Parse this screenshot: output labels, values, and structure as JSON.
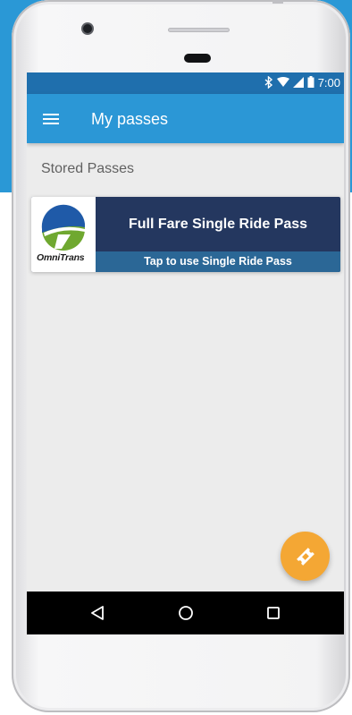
{
  "status_bar": {
    "time": "7:00",
    "icons": [
      "bluetooth-icon",
      "wifi-icon",
      "signal-icon",
      "battery-icon"
    ]
  },
  "app_bar": {
    "title": "My passes",
    "menu_icon": "menu-icon"
  },
  "content": {
    "section_heading": "Stored Passes",
    "passes": [
      {
        "agency_logo_text": "OmniTrans",
        "title": "Full Fare Single Ride Pass",
        "action_label": "Tap to use Single Ride Pass"
      }
    ]
  },
  "fab": {
    "icon": "ticket-icon"
  },
  "nav_bar": {
    "icons": [
      "back-icon",
      "home-icon",
      "recents-icon"
    ]
  },
  "colors": {
    "background_accent": "#2a98d6",
    "status_bar": "#1f6fad",
    "app_bar": "#2b97d6",
    "screen_background": "#ececec",
    "pass_card": "#24375f",
    "pass_action_strip": "#2b6796",
    "fab": "#f4a734",
    "logo_blue": "#1f5aa8",
    "logo_green": "#6fa830"
  }
}
